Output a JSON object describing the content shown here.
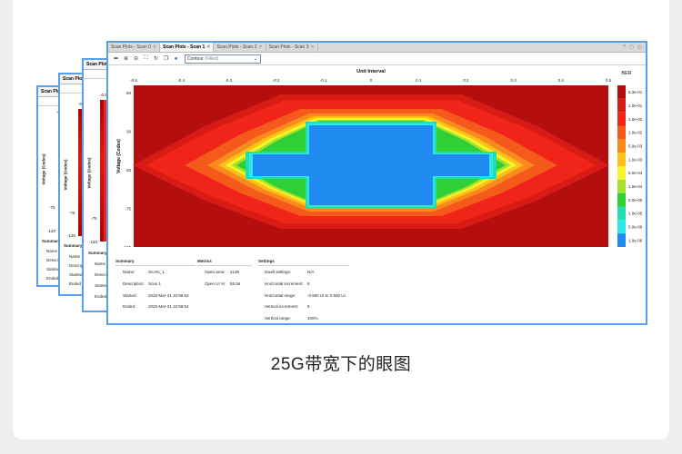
{
  "caption": "25G带宽下的眼图",
  "back_windows": [
    {
      "tab": "Scan Plots - Sc",
      "ylabel": "Voltage (Codes)",
      "ticks": [
        "-0.5",
        "-75",
        "-120"
      ],
      "summary": "Summary",
      "rows": [
        "Name",
        "Description",
        "Started",
        "Ended"
      ]
    },
    {
      "tab": "Scan Plots - S",
      "ylabel": "Voltage (Codes)",
      "ticks": [
        "-0.5",
        "-75",
        "-120"
      ],
      "summary": "Summary",
      "rows": [
        "Name",
        "Descript",
        "Started",
        "Ended"
      ]
    },
    {
      "tab": "Scan Plots - Sca",
      "ylabel": "Voltage (Codes)",
      "ticks": [
        "-0.5",
        "-75",
        "-120"
      ],
      "summary": "Summary",
      "rows": [
        "Name",
        "Descripti",
        "Started",
        "Ended"
      ]
    }
  ],
  "main": {
    "tabs": [
      {
        "label": "Scan Plots - Scan 0",
        "active": false
      },
      {
        "label": "Scan Plots - Scan 1",
        "active": true
      },
      {
        "label": "Scan Plots - Scan 2",
        "active": false
      },
      {
        "label": "Scan Plots - Scan 3",
        "active": false
      }
    ],
    "window_controls": {
      "help": "?",
      "restore": "▢",
      "maximize": "◫"
    },
    "toolbar": {
      "icons": [
        "back-icon",
        "zoom-in-icon",
        "zoom-out-icon",
        "fit-icon",
        "refresh-icon",
        "copy-icon",
        "info-icon"
      ],
      "plot_type": "Contour",
      "plot_type_suffix": "(Filled)"
    },
    "plot": {
      "title": "Unit Interval",
      "ylabel": "Voltage (Codes)",
      "x_ticks": [
        "-0.5",
        "-0.4",
        "-0.3",
        "-0.2",
        "-0.1",
        "0",
        "0.1",
        "0.2",
        "0.3",
        "0.4",
        "0.5"
      ],
      "y_ticks": [
        "90",
        "30",
        "-30",
        "-75",
        "-120"
      ],
      "legend_title": "BER",
      "legend": [
        {
          "label": "6.3e-01",
          "color": "#b50e0e"
        },
        {
          "label": "1.0e-01",
          "color": "#d81c15"
        },
        {
          "label": "1.0e-02",
          "color": "#f02418"
        },
        {
          "label": "1.0e-02",
          "color": "#f55a1c"
        },
        {
          "label": "5.0e-03",
          "color": "#f98a1e"
        },
        {
          "label": "1.0e-03",
          "color": "#fcc21a"
        },
        {
          "label": "5.0e-04",
          "color": "#f5f52a"
        },
        {
          "label": "1.0e-04",
          "color": "#a6e22c"
        },
        {
          "label": "5.0e-05",
          "color": "#2fcf36"
        },
        {
          "label": "1.0e-05",
          "color": "#22ddb0"
        },
        {
          "label": "5.0e-06",
          "color": "#2de8e8"
        },
        {
          "label": "1.0e-06",
          "color": "#1f8bf0"
        }
      ]
    },
    "summary": {
      "title": "Summary",
      "rows": [
        {
          "key": "Name:",
          "value": "SCAN_1"
        },
        {
          "key": "Description:",
          "value": "Scan 1"
        },
        {
          "key": "Started:",
          "value": "2025-Mar-31 10:58:53"
        },
        {
          "key": "Ended:",
          "value": "2025-Mar-31 10:58:54"
        }
      ]
    },
    "metrics": {
      "title": "Metrics",
      "rows": [
        {
          "key": "Open area:",
          "value": "2136"
        },
        {
          "key": "Open UI %:",
          "value": "55.56"
        }
      ]
    },
    "settings": {
      "title": "Settings",
      "rows": [
        {
          "key": "Dwell settings:",
          "value": "N/A"
        },
        {
          "key": "Horizontal increment:",
          "value": "8"
        },
        {
          "key": "Horizontal range:",
          "value": "-0.500 UI to 0.500 UI"
        },
        {
          "key": "Vertical increment:",
          "value": "8"
        },
        {
          "key": "Vertical range:",
          "value": "100%"
        }
      ]
    }
  }
}
